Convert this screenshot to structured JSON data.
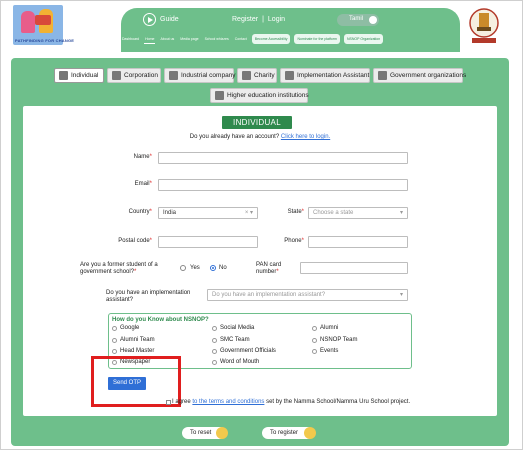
{
  "header": {
    "logo_text": "PATHFINDING FOR CHANGE",
    "guide_label": "Guide",
    "register_label": "Register",
    "separator": "|",
    "login_label": "Login",
    "language_label": "Tamil",
    "nav": [
      "Dashboard",
      "Home",
      "About us",
      "Media page",
      "School whizzes",
      "Contact"
    ],
    "nav_buttons": [
      "Become Accessibility",
      "Nominate for the platform",
      "NSNOP Organization"
    ]
  },
  "tabs": [
    {
      "label": "Individual",
      "icon": "person-icon",
      "active": true
    },
    {
      "label": "Corporation",
      "icon": "building-icon",
      "active": false
    },
    {
      "label": "Industrial company",
      "icon": "factory-icon",
      "active": false
    },
    {
      "label": "Charity",
      "icon": "charity-icon",
      "active": false
    },
    {
      "label": "Implementation Assistant",
      "icon": "people-icon",
      "active": false
    },
    {
      "label": "Government organizations",
      "icon": "emblem-icon",
      "active": false
    },
    {
      "label": "Higher education institutions",
      "icon": "school-icon",
      "active": false
    }
  ],
  "form": {
    "title": "INDIVIDUAL",
    "already_text": "Do you already have an account?",
    "login_link": "Click here to login.",
    "name_label": "Name",
    "email_label": "Email",
    "country_label": "Country",
    "country_value": "India",
    "state_label": "State",
    "state_placeholder": "Choose a state",
    "postal_label": "Postal code",
    "phone_label": "Phone",
    "former_student_label": "Are you a former student of a government school?",
    "yes_label": "Yes",
    "no_label": "No",
    "pan_label": "PAN card number",
    "impl_label": "Do you have an implementation assistant?",
    "impl_placeholder": "Do you have an implementation assistant?",
    "nsnop_title": "How do you Know about NSNOP?",
    "nsnop_options": [
      "Google",
      "Social Media",
      "Alumni",
      "Alumni Team",
      "SMC Team",
      "NSNOP Team",
      "Head Master",
      "Government Officials",
      "Events",
      "Newspaper",
      "Word of Mouth"
    ],
    "send_otp": "Send OTP",
    "agree_prefix": "I agree",
    "agree_link": "to the terms and conditions",
    "agree_suffix": "set by the Namma School/Namma Uru School project.",
    "reset_label": "To reset",
    "register_label": "To register"
  },
  "colors": {
    "brand_green": "#6ebf8b",
    "title_green": "#2f8a4d",
    "link_blue": "#2f6fd6",
    "highlight_red": "#e01e1e"
  }
}
